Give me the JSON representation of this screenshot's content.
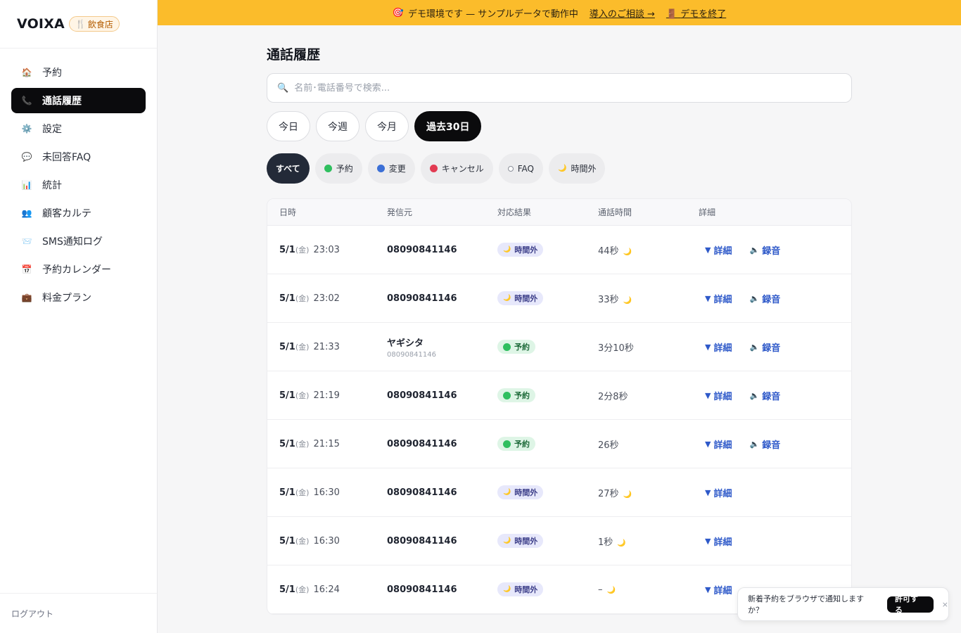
{
  "brand": {
    "name": "VOIXA",
    "badge_icon": "🍴",
    "badge_label": "飲食店"
  },
  "sidebar": {
    "items": [
      {
        "icon": "🏠",
        "label": "予約",
        "active": false
      },
      {
        "icon": "📞",
        "label": "通話履歴",
        "active": true
      },
      {
        "icon": "⚙️",
        "label": "設定",
        "active": false
      },
      {
        "icon": "💬",
        "label": "未回答FAQ",
        "active": false
      },
      {
        "icon": "📊",
        "label": "統計",
        "active": false
      },
      {
        "icon": "👥",
        "label": "顧客カルテ",
        "active": false
      },
      {
        "icon": "📨",
        "label": "SMS通知ログ",
        "active": false
      },
      {
        "icon": "📅",
        "label": "予約カレンダー",
        "active": false
      },
      {
        "icon": "💼",
        "label": "料金プラン",
        "active": false
      }
    ],
    "logout": "ログアウト"
  },
  "banner": {
    "icon": "🎯",
    "text": "デモ環境です — サンプルデータで動作中",
    "consult_link": "導入のご相談 →",
    "exit_icon": "🚪",
    "exit_link": "デモを終了"
  },
  "page": {
    "title": "通話履歴"
  },
  "search": {
    "placeholder": "名前･電話番号で検索..."
  },
  "periods": [
    {
      "label": "今日",
      "active": false
    },
    {
      "label": "今週",
      "active": false
    },
    {
      "label": "今月",
      "active": false
    },
    {
      "label": "過去30日",
      "active": true
    }
  ],
  "filters": [
    {
      "label": "すべて",
      "dot": "",
      "active": true
    },
    {
      "label": "予約",
      "dot": "green",
      "active": false
    },
    {
      "label": "変更",
      "dot": "blue",
      "active": false
    },
    {
      "label": "キャンセル",
      "dot": "red",
      "active": false
    },
    {
      "label": "FAQ",
      "dot": "hollow",
      "active": false
    },
    {
      "label": "時間外",
      "dot": "moon",
      "active": false
    }
  ],
  "table": {
    "headers": {
      "datetime": "日時",
      "caller": "発信元",
      "result": "対応結果",
      "duration": "通話時間",
      "detail": "詳細"
    },
    "detail_label": "詳細",
    "recording_label": "録音",
    "rows": [
      {
        "date": "5/1",
        "dow": "(金)",
        "time": "23:03",
        "caller": "08090841146",
        "caller_sub": "",
        "result": "時間外",
        "result_type": "night",
        "duration": "44秒",
        "moon": true,
        "recording": true
      },
      {
        "date": "5/1",
        "dow": "(金)",
        "time": "23:02",
        "caller": "08090841146",
        "caller_sub": "",
        "result": "時間外",
        "result_type": "night",
        "duration": "33秒",
        "moon": true,
        "recording": true
      },
      {
        "date": "5/1",
        "dow": "(金)",
        "time": "21:33",
        "caller": "ヤギシタ",
        "caller_sub": "08090841146",
        "result": "予約",
        "result_type": "reserve",
        "duration": "3分10秒",
        "moon": false,
        "recording": true
      },
      {
        "date": "5/1",
        "dow": "(金)",
        "time": "21:19",
        "caller": "08090841146",
        "caller_sub": "",
        "result": "予約",
        "result_type": "reserve",
        "duration": "2分8秒",
        "moon": false,
        "recording": true
      },
      {
        "date": "5/1",
        "dow": "(金)",
        "time": "21:15",
        "caller": "08090841146",
        "caller_sub": "",
        "result": "予約",
        "result_type": "reserve",
        "duration": "26秒",
        "moon": false,
        "recording": true
      },
      {
        "date": "5/1",
        "dow": "(金)",
        "time": "16:30",
        "caller": "08090841146",
        "caller_sub": "",
        "result": "時間外",
        "result_type": "night",
        "duration": "27秒",
        "moon": true,
        "recording": false
      },
      {
        "date": "5/1",
        "dow": "(金)",
        "time": "16:30",
        "caller": "08090841146",
        "caller_sub": "",
        "result": "時間外",
        "result_type": "night",
        "duration": "1秒",
        "moon": true,
        "recording": false
      },
      {
        "date": "5/1",
        "dow": "(金)",
        "time": "16:24",
        "caller": "08090841146",
        "caller_sub": "",
        "result": "時間外",
        "result_type": "night",
        "duration": "–",
        "moon": true,
        "recording": false
      }
    ]
  },
  "toast": {
    "message": "新着予約をブラウザで通知しますか？",
    "allow": "許可する",
    "close": "×"
  }
}
